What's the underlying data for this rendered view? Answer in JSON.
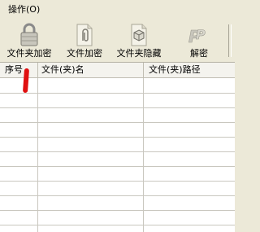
{
  "menubar": {
    "items": [
      {
        "label": "操作(O)"
      }
    ]
  },
  "toolbar": {
    "buttons": [
      {
        "label": "文件夹加密",
        "icon": "lock-icon"
      },
      {
        "label": "文件加密",
        "icon": "paperclip-document-icon"
      },
      {
        "label": "文件夹隐藏",
        "icon": "box-document-icon"
      },
      {
        "label": "解密",
        "icon": "pp-decrypt-icon"
      }
    ]
  },
  "table": {
    "columns": [
      {
        "label": "序号"
      },
      {
        "label": "文件(夹)名"
      },
      {
        "label": "文件(夹)路径"
      }
    ],
    "rows": []
  },
  "colors": {
    "annotation_mark": "#e01010",
    "window_bg": "#ece9d8"
  }
}
